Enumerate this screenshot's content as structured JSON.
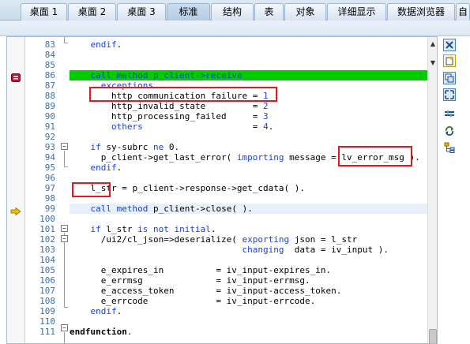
{
  "tabs": [
    {
      "label": "桌面 1",
      "active": false
    },
    {
      "label": "桌面 2",
      "active": false
    },
    {
      "label": "桌面 3",
      "active": false
    },
    {
      "label": "标准",
      "active": true
    },
    {
      "label": "结构",
      "active": false
    },
    {
      "label": "表",
      "active": false
    },
    {
      "label": "对象",
      "active": false
    },
    {
      "label": "详细显示",
      "active": false
    },
    {
      "label": "数据浏览器",
      "active": false
    },
    {
      "label": "自",
      "active": false
    }
  ],
  "editor": {
    "lines": [
      {
        "num": "83",
        "text": "    endif."
      },
      {
        "num": "84",
        "text": ""
      },
      {
        "num": "85",
        "text": ""
      },
      {
        "num": "86",
        "text": "    call method p_client->receive"
      },
      {
        "num": "87",
        "text": "      exceptions"
      },
      {
        "num": "88",
        "text": "        http_communication_failure = 1"
      },
      {
        "num": "89",
        "text": "        http_invalid_state         = 2"
      },
      {
        "num": "90",
        "text": "        http_processing_failed     = 3"
      },
      {
        "num": "91",
        "text": "        others                     = 4."
      },
      {
        "num": "92",
        "text": ""
      },
      {
        "num": "93",
        "text": "    if sy-subrc ne 0."
      },
      {
        "num": "94",
        "text": "      p_client->get_last_error( importing message = lv_error_msg )."
      },
      {
        "num": "95",
        "text": "    endif."
      },
      {
        "num": "96",
        "text": ""
      },
      {
        "num": "97",
        "text": "    l_str = p_client->response->get_cdata( )."
      },
      {
        "num": "98",
        "text": ""
      },
      {
        "num": "99",
        "text": "    call method p_client->close( )."
      },
      {
        "num": "100",
        "text": ""
      },
      {
        "num": "101",
        "text": "    if l_str is not initial."
      },
      {
        "num": "102",
        "text": "      /ui2/cl_json=>deserialize( exporting json = l_str"
      },
      {
        "num": "103",
        "text": "                                 changing  data = iv_input )."
      },
      {
        "num": "104",
        "text": ""
      },
      {
        "num": "105",
        "text": "      e_expires_in          = iv_input-expires_in."
      },
      {
        "num": "106",
        "text": "      e_errmsg              = iv_input-errmsg."
      },
      {
        "num": "107",
        "text": "      e_access_token        = iv_input-access_token."
      },
      {
        "num": "108",
        "text": "      e_errcode             = iv_input-errcode."
      },
      {
        "num": "109",
        "text": "    endif."
      },
      {
        "num": "110",
        "text": ""
      },
      {
        "num": "111",
        "text": "endfunction."
      }
    ]
  },
  "colors": {
    "keyword": "#1a3ee0",
    "line_number": "#3d6fa8",
    "current_line": "#00cc00",
    "debug_line": "#e8f0fb",
    "annotation_box": "#e8161e"
  },
  "icons": {
    "breakpoint": "breakpoint-icon",
    "current_statement": "current-statement-arrow-icon",
    "toolbar": [
      "close-icon",
      "new-icon",
      "copy-icon",
      "fullscreen-icon",
      "settings-icon",
      "refresh-icon",
      "structure-icon"
    ]
  }
}
